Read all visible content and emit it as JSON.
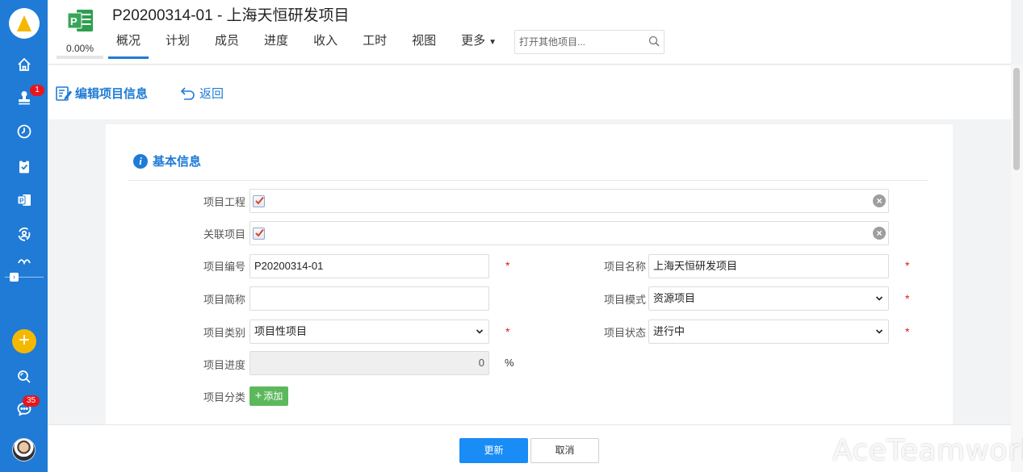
{
  "header": {
    "title": "P20200314-01 - 上海天恒研发项目",
    "progress": "0.00%",
    "tabs": [
      {
        "label": "概况"
      },
      {
        "label": "计划"
      },
      {
        "label": "成员"
      },
      {
        "label": "进度"
      },
      {
        "label": "收入"
      },
      {
        "label": "工时"
      },
      {
        "label": "视图"
      },
      {
        "label": "更多"
      }
    ],
    "search_placeholder": "打开其他项目..."
  },
  "sidebar": {
    "badges": {
      "stamp": "1",
      "chat": "35"
    }
  },
  "toolbar": {
    "edit_label": "编辑项目信息",
    "back_label": "返回"
  },
  "form": {
    "section_title": "基本信息",
    "labels": {
      "engineering": "项目工程",
      "related": "关联项目",
      "code": "项目编号",
      "name": "项目名称",
      "short_name": "项目简称",
      "mode": "项目模式",
      "category": "项目类别",
      "status": "项目状态",
      "progress": "项目进度",
      "classification": "项目分类"
    },
    "values": {
      "code": "P20200314-01",
      "name": "上海天恒研发项目",
      "short_name": "",
      "mode": "资源项目",
      "category": "项目性项目",
      "status": "进行中",
      "progress": "0"
    },
    "required_mark": "*",
    "progress_unit": "%",
    "add_label": "添加"
  },
  "actions": {
    "update_label": "更新",
    "cancel_label": "取消"
  },
  "watermark": "AceTeamwork",
  "colors": {
    "sidebar": "#1f7bd6",
    "accent": "#1f7bd6",
    "primary_button": "#1a8cf5",
    "add_button": "#5cb85c",
    "badge": "#e7161d",
    "fab": "#f5b800"
  }
}
